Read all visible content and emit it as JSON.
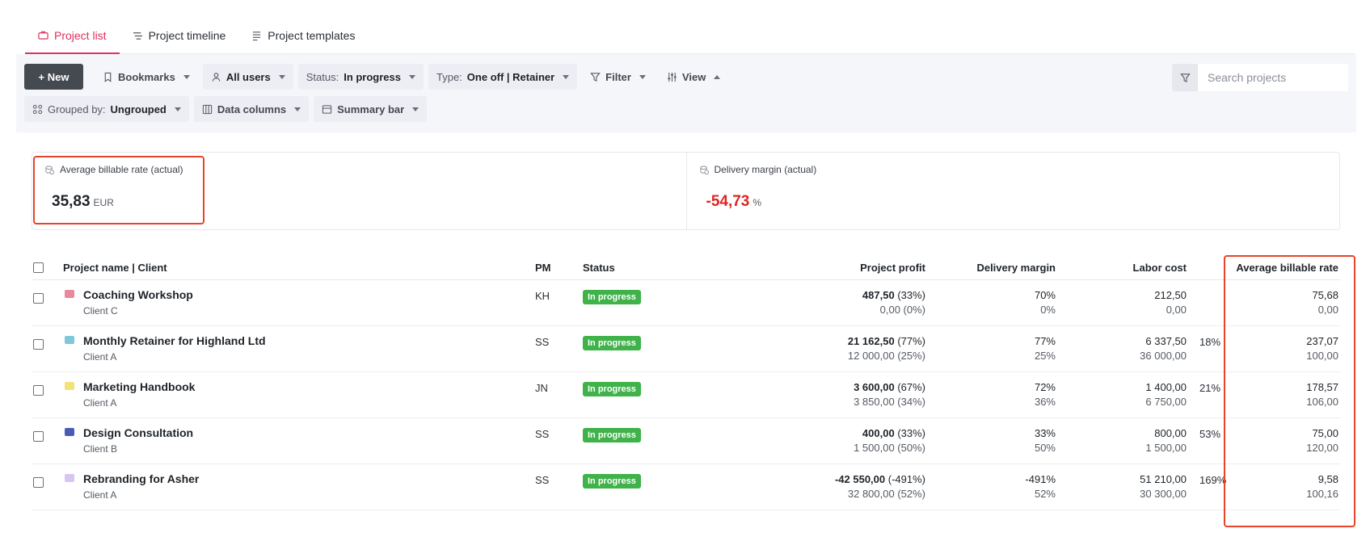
{
  "tabs": [
    {
      "label": "Project list",
      "icon": "briefcase-icon",
      "active": true
    },
    {
      "label": "Project timeline",
      "icon": "timeline-icon",
      "active": false
    },
    {
      "label": "Project templates",
      "icon": "list-icon",
      "active": false
    }
  ],
  "toolbar": {
    "new_label": "+ New",
    "bookmarks": "Bookmarks",
    "users": "All users",
    "status_label": "Status:",
    "status_value": "In progress",
    "type_label": "Type:",
    "type_value": "One off | Retainer",
    "filter": "Filter",
    "view": "View",
    "grouped_label": "Grouped by:",
    "grouped_value": "Ungrouped",
    "data_columns": "Data columns",
    "summary_bar": "Summary bar",
    "search_placeholder": "Search projects"
  },
  "summary": [
    {
      "title": "Average billable rate (actual)",
      "value": "35,83",
      "unit": "EUR",
      "negative": false
    },
    {
      "title": "Delivery margin (actual)",
      "value": "-54,73",
      "unit": "%",
      "negative": true
    }
  ],
  "table": {
    "headers": {
      "name": "Project name | Client",
      "pm": "PM",
      "status": "Status",
      "profit": "Project profit",
      "margin": "Delivery margin",
      "labor": "Labor cost",
      "rate": "Average billable rate"
    },
    "rows": [
      {
        "name": "Coaching Workshop",
        "client": "Client C",
        "icon_color": "#e8889a",
        "pm": "KH",
        "status": "In progress",
        "profit_main": "487,50",
        "profit_pct": "(33%)",
        "profit_sub": "0,00 (0%)",
        "margin_main": "70%",
        "margin_sub": "0%",
        "labor_main": "212,50",
        "labor_sub": "0,00",
        "labor_pct": "",
        "rate_main": "75,68",
        "rate_sub": "0,00"
      },
      {
        "name": "Monthly Retainer for Highland Ltd",
        "client": "Client A",
        "icon_color": "#7fc7d9",
        "pm": "SS",
        "status": "In progress",
        "profit_main": "21 162,50",
        "profit_pct": "(77%)",
        "profit_sub": "12 000,00 (25%)",
        "margin_main": "77%",
        "margin_sub": "25%",
        "labor_main": "6 337,50",
        "labor_sub": "36 000,00",
        "labor_pct": "18%",
        "rate_main": "237,07",
        "rate_sub": "100,00"
      },
      {
        "name": "Marketing Handbook",
        "client": "Client A",
        "icon_color": "#f3e17a",
        "pm": "JN",
        "status": "In progress",
        "profit_main": "3 600,00",
        "profit_pct": "(67%)",
        "profit_sub": "3 850,00 (34%)",
        "margin_main": "72%",
        "margin_sub": "36%",
        "labor_main": "1 400,00",
        "labor_sub": "6 750,00",
        "labor_pct": "21%",
        "rate_main": "178,57",
        "rate_sub": "106,00"
      },
      {
        "name": "Design Consultation",
        "client": "Client B",
        "icon_color": "#4a5bb5",
        "pm": "SS",
        "status": "In progress",
        "profit_main": "400,00",
        "profit_pct": "(33%)",
        "profit_sub": "1 500,00 (50%)",
        "margin_main": "33%",
        "margin_sub": "50%",
        "labor_main": "800,00",
        "labor_sub": "1 500,00",
        "labor_pct": "53%",
        "rate_main": "75,00",
        "rate_sub": "120,00"
      },
      {
        "name": "Rebranding for Asher",
        "client": "Client A",
        "icon_color": "#d8c6f0",
        "pm": "SS",
        "status": "In progress",
        "profit_main": "-42 550,00",
        "profit_pct": "(-491%)",
        "profit_sub": "32 800,00 (52%)",
        "margin_main": "-491%",
        "margin_sub": "52%",
        "labor_main": "51 210,00",
        "labor_sub": "30 300,00",
        "labor_pct": "169%",
        "rate_main": "9,58",
        "rate_sub": "100,16"
      }
    ]
  },
  "colors": {
    "accent": "#e0315f",
    "status_green": "#3fb24a",
    "negative": "#e02424",
    "highlight": "#e8442a"
  }
}
